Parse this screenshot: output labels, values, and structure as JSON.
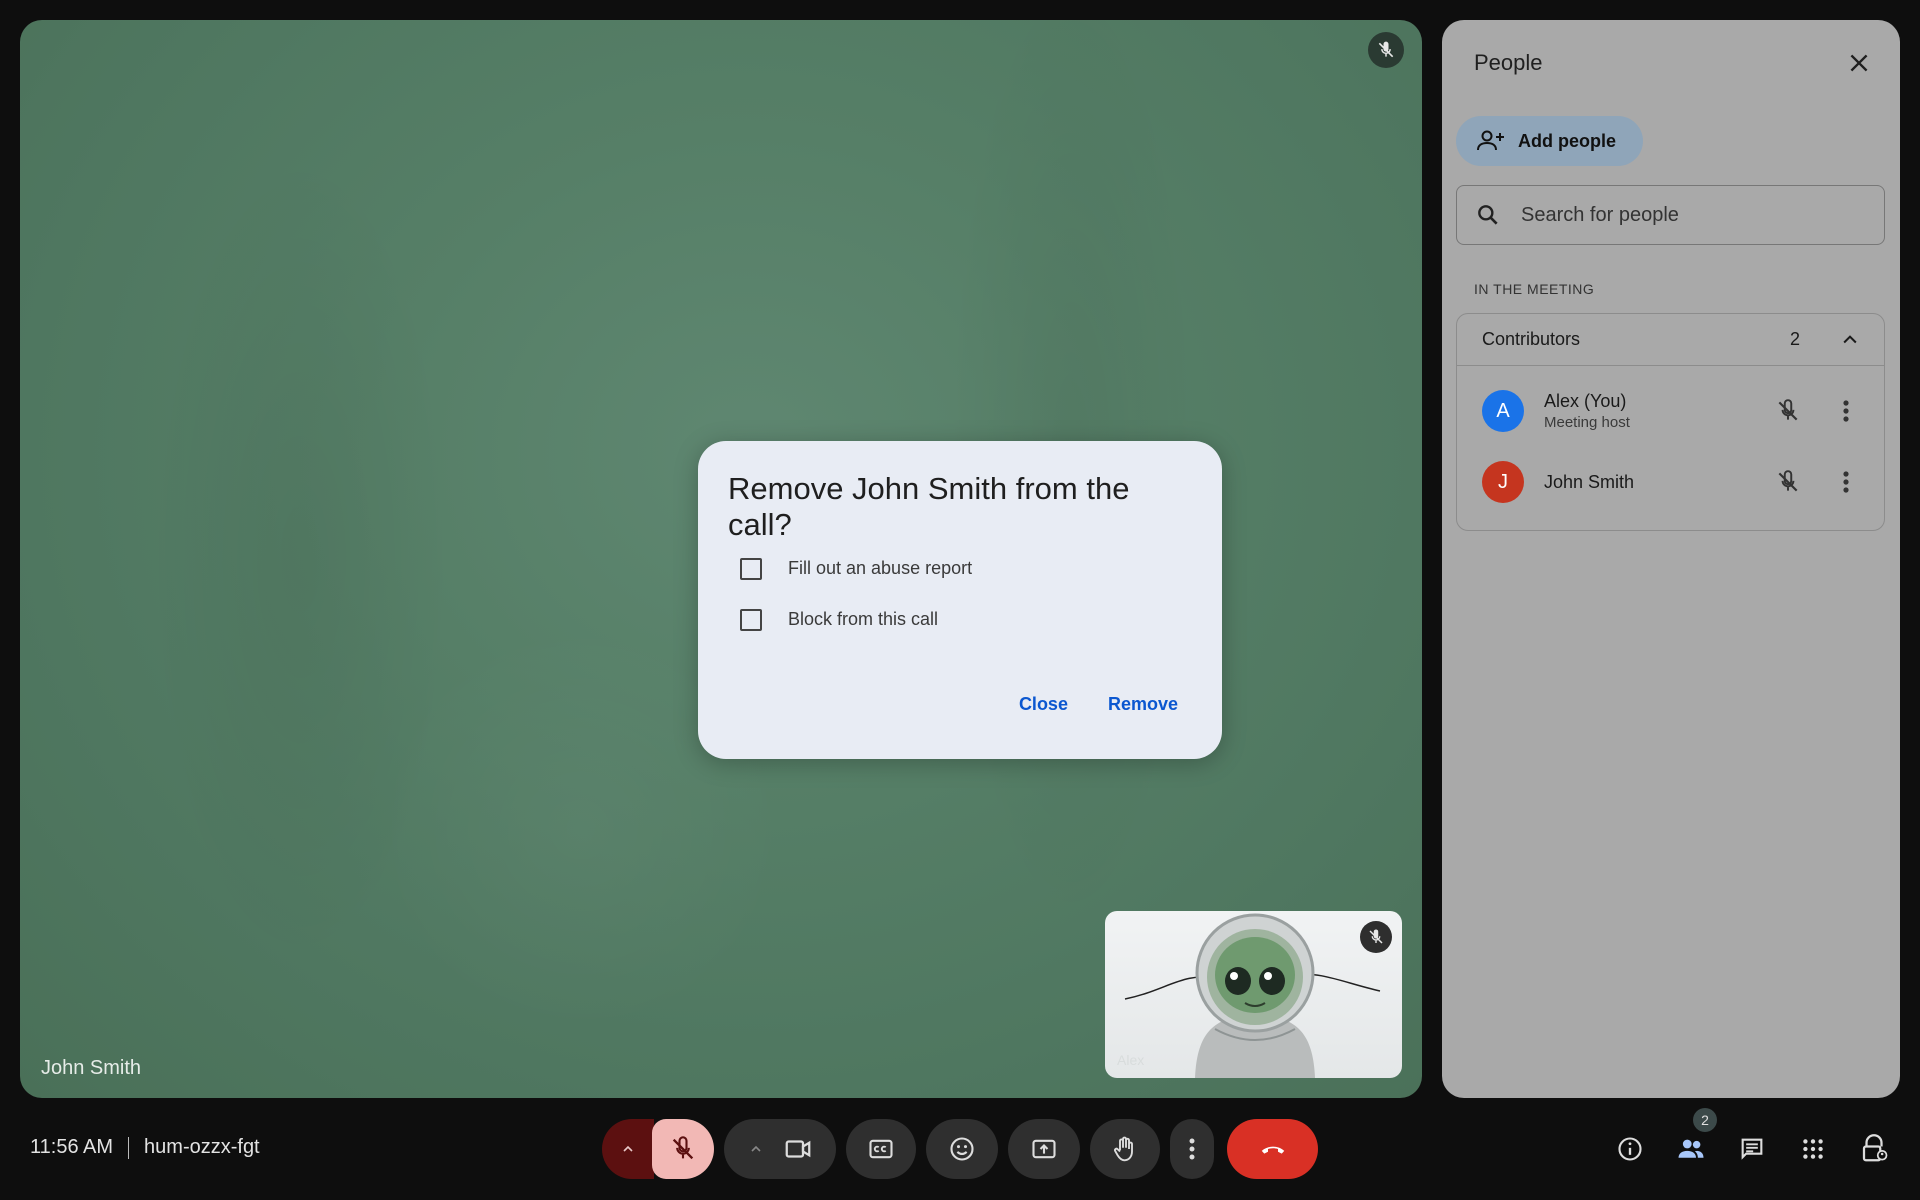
{
  "stage": {
    "participant_name": "John Smith"
  },
  "self_tile": {
    "name": "Alex"
  },
  "dialog": {
    "title": "Remove John Smith from the call?",
    "options": [
      {
        "label": "Fill out an abuse report",
        "checked": false
      },
      {
        "label": "Block from this call",
        "checked": false
      }
    ],
    "close_label": "Close",
    "remove_label": "Remove"
  },
  "panel": {
    "title": "People",
    "add_people_label": "Add people",
    "search_placeholder": "Search for people",
    "section_label": "IN THE MEETING",
    "group": {
      "label": "Contributors",
      "count": "2",
      "people": [
        {
          "initial": "A",
          "name": "Alex (You)",
          "role": "Meeting host",
          "color": "#1a73e8"
        },
        {
          "initial": "J",
          "name": "John Smith",
          "role": "",
          "color": "#c5351f"
        }
      ]
    }
  },
  "bottom_bar": {
    "time": "11:56 AM",
    "meeting_code": "hum-ozzx-fgt",
    "people_badge": "2",
    "icons": [
      "chevron-up-icon",
      "mic-off-icon",
      "chevron-up-icon",
      "camera-icon",
      "captions-icon",
      "emoji-icon",
      "present-icon",
      "raise-hand-icon",
      "more-vert-icon",
      "end-call-icon",
      "info-icon",
      "people-icon",
      "chat-icon",
      "apps-icon",
      "lock-person-icon"
    ]
  },
  "colors": {
    "end_call": "#d93025",
    "mic_off_bg": "#f2b8b5",
    "mic_chevron_bg": "#5c1010",
    "accent": "#0b57d0"
  }
}
